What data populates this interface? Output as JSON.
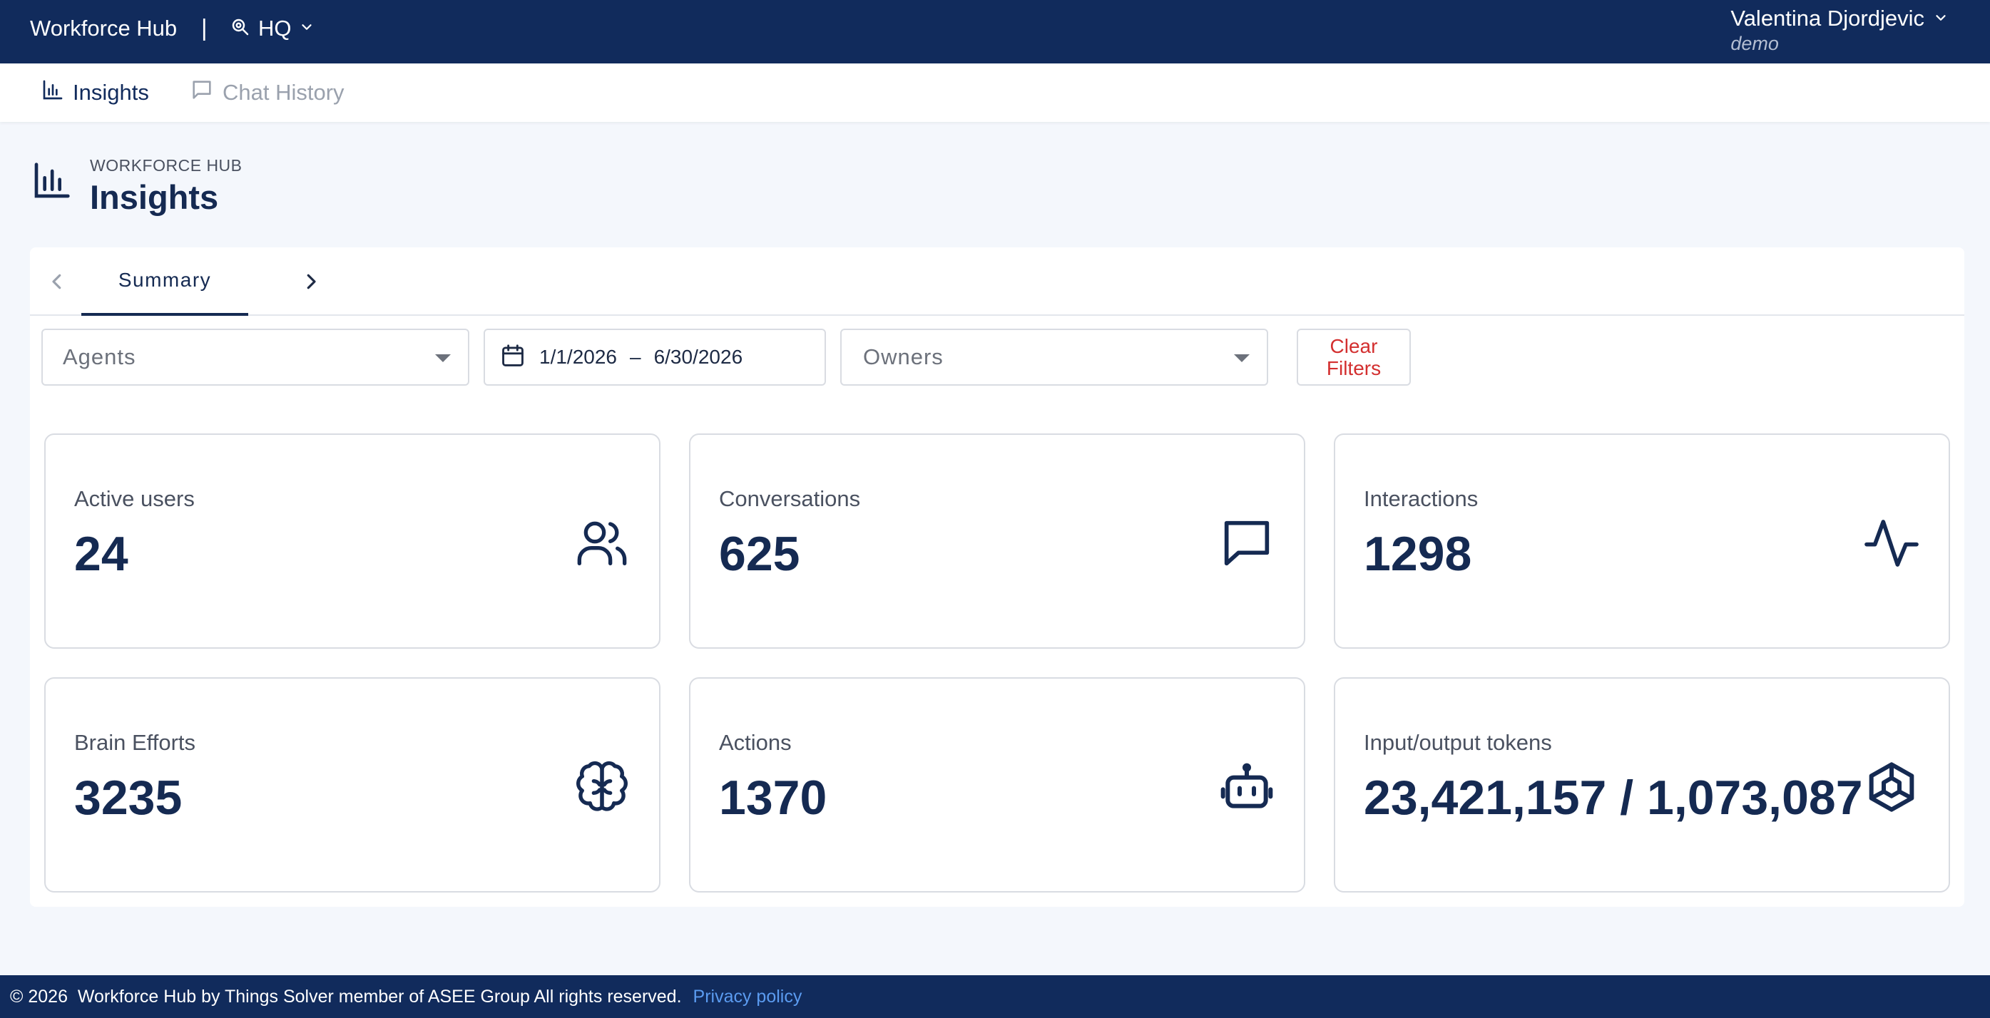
{
  "topbar": {
    "brand": "Workforce Hub",
    "separator": "|",
    "site": "HQ",
    "user_name": "Valentina Djordjevic",
    "user_role": "demo"
  },
  "nav": {
    "insights": "Insights",
    "chat_history": "Chat History"
  },
  "page": {
    "eyebrow": "WORKFORCE HUB",
    "title": "Insights"
  },
  "tabs": {
    "active": "Summary"
  },
  "filters": {
    "agents_placeholder": "Agents",
    "date_start": "1/1/2026",
    "date_sep": "–",
    "date_end": "6/30/2026",
    "owners_placeholder": "Owners",
    "clear_label_1": "Clear",
    "clear_label_2": "Filters"
  },
  "metrics": [
    {
      "label": "Active users",
      "value": "24",
      "icon": "users-icon"
    },
    {
      "label": "Conversations",
      "value": "625",
      "icon": "chat-bubble-icon"
    },
    {
      "label": "Interactions",
      "value": "1298",
      "icon": "activity-icon"
    },
    {
      "label": "Brain Efforts",
      "value": "3235",
      "icon": "brain-icon"
    },
    {
      "label": "Actions",
      "value": "1370",
      "icon": "bot-icon"
    },
    {
      "label": "Input/output tokens",
      "value": "23,421,157 / 1,073,087",
      "icon": "cube-icon"
    }
  ],
  "footer": {
    "copyright": "© 2026  Workforce Hub by Things Solver member of ASEE Group All rights reserved.",
    "privacy": "Privacy policy"
  },
  "colors": {
    "primary": "#112b5c",
    "accent_link": "#5b9bf0",
    "danger": "#d32f2f",
    "background": "#f4f7fc"
  }
}
